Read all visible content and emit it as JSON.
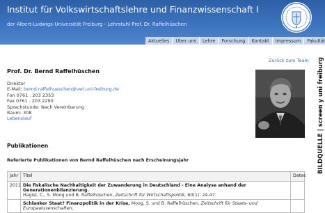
{
  "header": {
    "title": "Institut für Volkswirtschaftslehre und Finanzwissenschaft I",
    "subtitle": "der Albert-Ludwigs-Universität Freiburg - Lehrstuhl Prof. Dr. Raffelhüschen",
    "logo_icon": "university-seal-icon"
  },
  "nav": {
    "items": [
      "Aktuelles",
      "Über uns",
      "Lehre",
      "Forschung",
      "Kontakt",
      "Impressum",
      "Fakultät"
    ]
  },
  "side_label": "BILDQUELLE | screen y uni freiburg",
  "back_link": "Zurück zum Team",
  "person": {
    "name": "Prof. Dr. Bernd Raffelhüschen",
    "role": "Direktor",
    "email_label": "E-Mail:",
    "email": "bernd.raffelhueschen@vwl.uni-freiburg.de",
    "phone": "Fon 0761 . 203 2353",
    "fax": "Fax 0761 . 203 2290",
    "office_hours": "Sprechstunde: Nach Vereinbarung",
    "room": "Raum: 308",
    "cv_link": "Lebenslauf"
  },
  "publications": {
    "heading": "Publikationen",
    "subheading": "Referierte Publikationen von Bernd Raffelhüschen nach Erscheinungsjahr",
    "columns": {
      "year": "Jahr",
      "title": "Titel",
      "dates": "Dates"
    },
    "rows": [
      {
        "year": "2011",
        "title": "Die fiskalische Nachhaltigkeit der Zuwanderung in Deutschland - Eine Analyse anhand der Generationenbilanzierung.",
        "authors": "Hagist, C., S. Moog und B. Raffelhüschen,",
        "journal": "Zeitschrift für Wirtschaftspolitik,",
        "details": "60(1), 24-47."
      },
      {
        "year": "",
        "title": "Schlanker Staat? Finanzpolitik in der Krise,",
        "authors": "Moog, S. und B. Raffelhüschen,",
        "journal": "Zeitschrift für Staats- und Europawissenschaften,",
        "details": ""
      }
    ]
  },
  "colors": {
    "header_top": "#2d5fa6",
    "header_bottom": "#4f86cc",
    "nav_bg": "#c9d7ea",
    "link": "#3a6fb5"
  }
}
